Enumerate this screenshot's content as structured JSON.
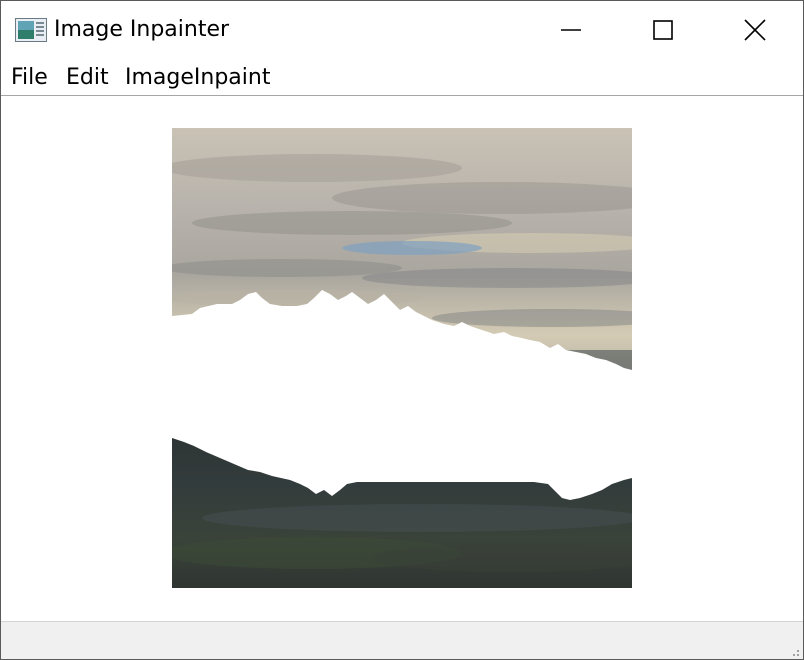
{
  "window": {
    "title": "Image Inpainter",
    "icon": "app-image-icon",
    "controls": [
      "minimize-icon",
      "maximize-icon",
      "close-icon"
    ]
  },
  "menubar": {
    "items": [
      {
        "label": "File"
      },
      {
        "label": "Edit"
      },
      {
        "label": "ImageInpaint"
      }
    ]
  },
  "canvas": {
    "content": "landscape photo with masked (white) region to inpaint",
    "mask_color": "#ffffff"
  },
  "statusbar": {
    "text": ""
  }
}
